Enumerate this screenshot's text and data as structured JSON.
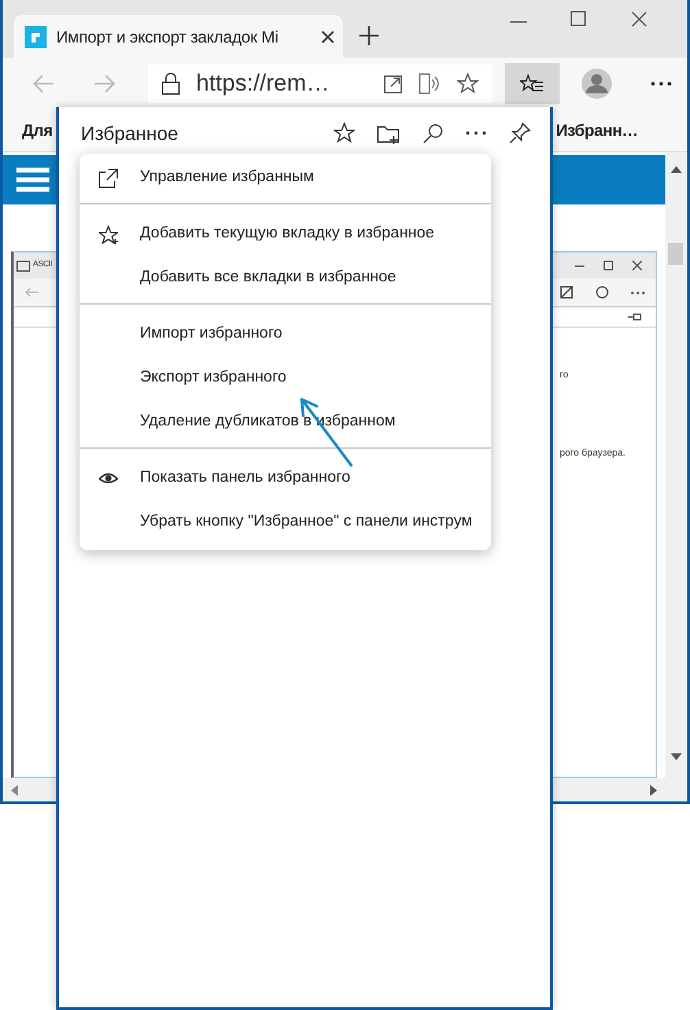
{
  "browser": {
    "tab_title": "Импорт и экспорт закладок Mi",
    "address": "https://rem…",
    "bookmarks_bar": [
      "Для",
      "Избранн…"
    ]
  },
  "inner_screenshot": {
    "title": "ASCII",
    "texts": [
      "го",
      "рого браузера."
    ]
  },
  "favorites_panel": {
    "title": "Избранное"
  },
  "menu": {
    "sections": [
      [
        {
          "label": "Управление избранным",
          "kind": "external"
        }
      ],
      [
        {
          "label": "Добавить текущую вкладку в избранное",
          "kind": "star"
        },
        {
          "label": "Добавить все вкладки в избранное",
          "kind": "plain"
        }
      ],
      [
        {
          "label": "Импорт избранного",
          "kind": "plain"
        },
        {
          "label": "Экспорт избранного",
          "kind": "plain"
        },
        {
          "label": "Удаление дубликатов в избранном",
          "kind": "plain"
        }
      ],
      [
        {
          "label": "Показать панель избранного",
          "kind": "eye"
        },
        {
          "label": "Убрать кнопку \"Избранное\" с панели инструм",
          "kind": "plain"
        }
      ]
    ]
  }
}
